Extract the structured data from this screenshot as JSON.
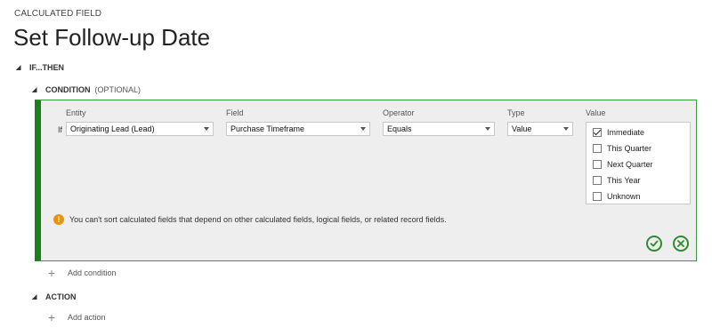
{
  "header": {
    "supertitle": "CALCULATED FIELD",
    "title": "Set Follow-up Date"
  },
  "sections": {
    "ifthen": "IF...THEN",
    "condition": "CONDITION",
    "condition_optional": "(OPTIONAL)",
    "action": "ACTION"
  },
  "condition": {
    "if_label": "If",
    "columns": {
      "entity": "Entity",
      "field": "Field",
      "operator": "Operator",
      "type": "Type",
      "value": "Value"
    },
    "entity_value": "Originating Lead (Lead)",
    "field_value": "Purchase Timeframe",
    "operator_value": "Equals",
    "type_value": "Value",
    "value_options": [
      {
        "label": "Immediate",
        "checked": true
      },
      {
        "label": "This Quarter",
        "checked": false
      },
      {
        "label": "Next Quarter",
        "checked": false
      },
      {
        "label": "This Year",
        "checked": false
      },
      {
        "label": "Unknown",
        "checked": false
      }
    ],
    "warning": "You can't sort calculated fields that depend on other calculated fields, logical fields, or related record fields.",
    "accent_color": "#1e7f1e",
    "warning_color": "#e8930c"
  },
  "actions": {
    "add_condition": "Add condition",
    "add_action": "Add action"
  }
}
